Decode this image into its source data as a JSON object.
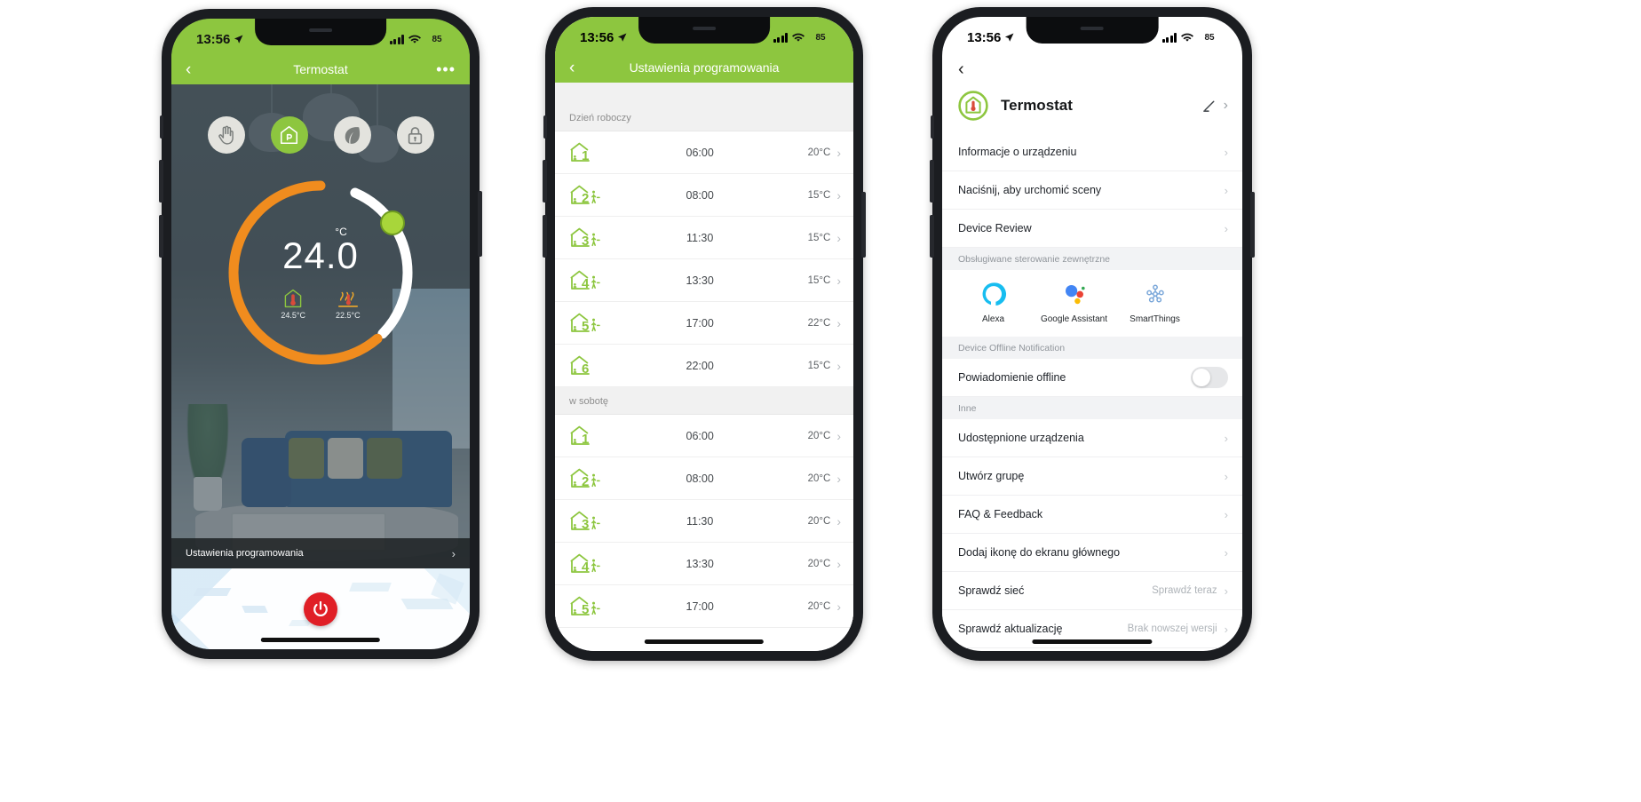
{
  "status_bar": {
    "time": "13:56",
    "battery": "85",
    "location_icon": "location-arrow-icon",
    "signal_icon": "cellular-bars-icon",
    "wifi_icon": "wifi-icon"
  },
  "phone1": {
    "navbar": {
      "back": "‹",
      "title": "Termostat",
      "more": "•••"
    },
    "modes": [
      {
        "name": "manual",
        "icon": "hand-icon",
        "active": false
      },
      {
        "name": "program",
        "icon": "house-p-icon",
        "active": true
      },
      {
        "name": "eco",
        "icon": "leaf-icon",
        "active": false
      },
      {
        "name": "lock",
        "icon": "padlock-icon",
        "active": false
      }
    ],
    "dial": {
      "unit": "°C",
      "target": "24.0",
      "room_temp": "24.5°C",
      "room_icon": "house-thermometer-icon",
      "floor_temp": "22.5°C",
      "floor_icon": "heating-thermometer-icon"
    },
    "schedule_bar": {
      "label": "Ustawienia programowania",
      "chevron": "›"
    },
    "power_button": {
      "icon": "power-icon",
      "color": "#e01f26"
    }
  },
  "phone2": {
    "navbar": {
      "back": "‹",
      "title": "Ustawienia programowania"
    },
    "sections": [
      {
        "header": "Dzień roboczy",
        "rows": [
          {
            "slot": "1",
            "icon": "house-person-1-icon",
            "time": "06:00",
            "temp": "20°C",
            "chevron": "›"
          },
          {
            "slot": "2",
            "icon": "house-person-2-icon",
            "time": "08:00",
            "temp": "15°C",
            "chevron": "›"
          },
          {
            "slot": "3",
            "icon": "house-person-3-icon",
            "time": "11:30",
            "temp": "15°C",
            "chevron": "›"
          },
          {
            "slot": "4",
            "icon": "house-person-4-icon",
            "time": "13:30",
            "temp": "15°C",
            "chevron": "›"
          },
          {
            "slot": "5",
            "icon": "house-person-5-icon",
            "time": "17:00",
            "temp": "22°C",
            "chevron": "›"
          },
          {
            "slot": "6",
            "icon": "house-person-6-icon",
            "time": "22:00",
            "temp": "15°C",
            "chevron": "›"
          }
        ]
      },
      {
        "header": "w sobotę",
        "rows": [
          {
            "slot": "1",
            "icon": "house-person-1-icon",
            "time": "06:00",
            "temp": "20°C",
            "chevron": "›"
          },
          {
            "slot": "2",
            "icon": "house-person-2-icon",
            "time": "08:00",
            "temp": "20°C",
            "chevron": "›"
          },
          {
            "slot": "3",
            "icon": "house-person-3-icon",
            "time": "11:30",
            "temp": "20°C",
            "chevron": "›"
          },
          {
            "slot": "4",
            "icon": "house-person-4-icon",
            "time": "13:30",
            "temp": "20°C",
            "chevron": "›"
          },
          {
            "slot": "5",
            "icon": "house-person-5-icon",
            "time": "17:00",
            "temp": "20°C",
            "chevron": "›"
          }
        ]
      }
    ]
  },
  "phone3": {
    "back": "‹",
    "device": {
      "name": "Termostat",
      "icon": "house-thermometer-icon",
      "edit_icon": "pencil-icon",
      "chevron": "›"
    },
    "items_top": [
      {
        "label": "Informacje o urządzeniu",
        "chevron": "›"
      },
      {
        "label": "Naciśnij, aby urchomić sceny",
        "chevron": "›"
      },
      {
        "label": "Device Review",
        "chevron": "›"
      }
    ],
    "external_section": {
      "header": "Obsługiwane sterowanie zewnętrzne"
    },
    "assistants": [
      {
        "label": "Alexa",
        "icon": "alexa-icon"
      },
      {
        "label": "Google Assistant",
        "icon": "google-assistant-icon"
      },
      {
        "label": "SmartThings",
        "icon": "smartthings-icon"
      }
    ],
    "offline_section": {
      "header": "Device Offline Notification"
    },
    "offline_row": {
      "label": "Powiadomienie offline",
      "toggle_on": false
    },
    "other_section": {
      "header": "Inne"
    },
    "items_other": [
      {
        "label": "Udostępnione urządzenia",
        "value": "",
        "chevron": "›"
      },
      {
        "label": "Utwórz grupę",
        "value": "",
        "chevron": "›"
      },
      {
        "label": "FAQ & Feedback",
        "value": "",
        "chevron": "›"
      },
      {
        "label": "Dodaj ikonę do ekranu głównego",
        "value": "",
        "chevron": "›"
      },
      {
        "label": "Sprawdź sieć",
        "value": "Sprawdź teraz",
        "chevron": "›"
      },
      {
        "label": "Sprawdź aktualizację",
        "value": "Brak nowszej wersji",
        "chevron": "›"
      }
    ]
  },
  "colors": {
    "brand_green": "#8dc63f",
    "arc_orange": "#f08c1e",
    "power_red": "#e01f26",
    "handle_green": "#a8d63a"
  }
}
